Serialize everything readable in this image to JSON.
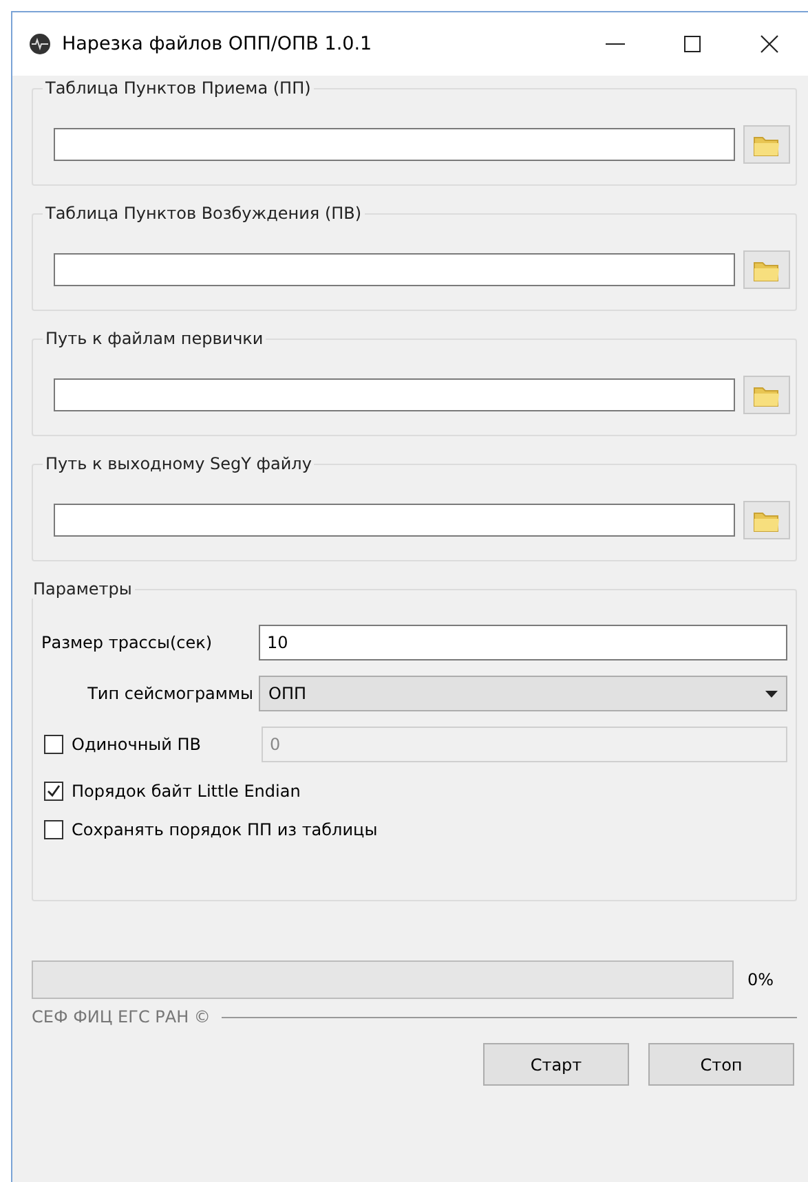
{
  "window": {
    "title": "Нарезка файлов ОПП/ОПВ 1.0.1"
  },
  "path_groups": [
    {
      "label": "Таблица Пунктов Приема (ПП)"
    },
    {
      "label": "Таблица Пунктов Возбуждения (ПВ)"
    },
    {
      "label": "Путь к файлам первички"
    },
    {
      "label": "Путь к выходному SegY файлу"
    }
  ],
  "parameters": {
    "title": "Параметры",
    "trace_size": {
      "label": "Размер трассы(сек)",
      "value": "10"
    },
    "seismogram_type": {
      "label": "Тип сейсмограммы",
      "value": "ОПП"
    },
    "single_shot": {
      "label": "Одиночный ПВ",
      "checked": false,
      "value": "0",
      "disabled": true
    },
    "options": [
      {
        "label": "Порядок байт Little Endian",
        "checked": true
      },
      {
        "label": "Сохранять порядок ПП из таблицы",
        "checked": false
      }
    ]
  },
  "progress": {
    "level": 0,
    "reading": "0%"
  },
  "footer": "СЕФ ФИЦ ЕГС РАН ©",
  "buttons": [
    "Старт",
    "Стоп"
  ]
}
